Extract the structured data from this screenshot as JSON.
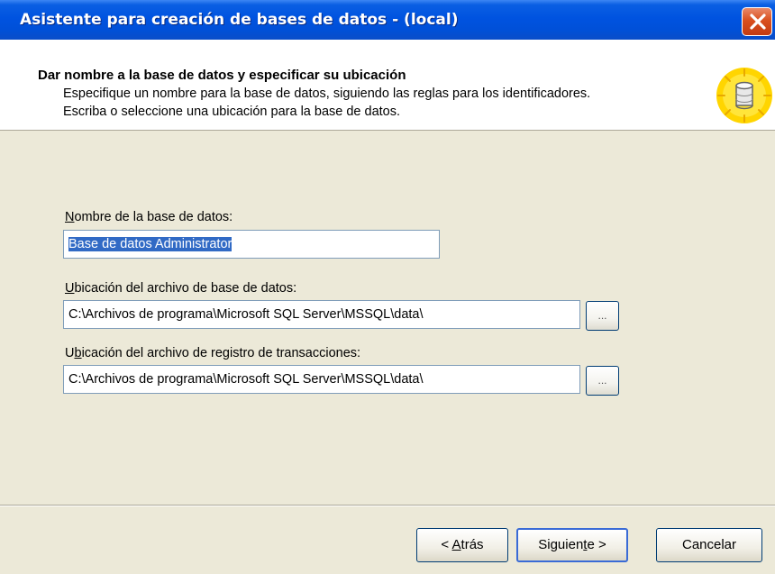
{
  "window": {
    "title": "Asistente para creación de bases de datos - (local)"
  },
  "header": {
    "title": "Dar nombre a la base de datos y especificar su ubicación",
    "line1": "Especifique un nombre para la base de datos, siguiendo las reglas para los identificadores.",
    "line2": "Escriba o seleccione una ubicación para la base de datos."
  },
  "form": {
    "name_label_mnemonic": "N",
    "name_label_rest": "ombre de la base de datos:",
    "name_value": "Base de datos Administrator",
    "data_label_mnemonic": "U",
    "data_label_rest": "bicación del archivo de base de datos:",
    "data_value": "C:\\Archivos de programa\\Microsoft SQL Server\\MSSQL\\data\\",
    "log_label_pre": "U",
    "log_label_mnemonic": "b",
    "log_label_rest": "icación del archivo de registro de transacciones:",
    "log_value": "C:\\Archivos de programa\\Microsoft SQL Server\\MSSQL\\data\\",
    "browse_label": "..."
  },
  "buttons": {
    "back_pre": "< ",
    "back_mnemonic": "A",
    "back_rest": "trás",
    "next_pre": "Siguien",
    "next_mnemonic": "t",
    "next_rest": "e >",
    "cancel": "Cancelar"
  },
  "icons": {
    "close": "close-icon",
    "database": "database-icon"
  },
  "colors": {
    "titlebar": "#0053e0",
    "dialog": "#ece9d8",
    "selection": "#316ac5",
    "close": "#d9501f"
  }
}
